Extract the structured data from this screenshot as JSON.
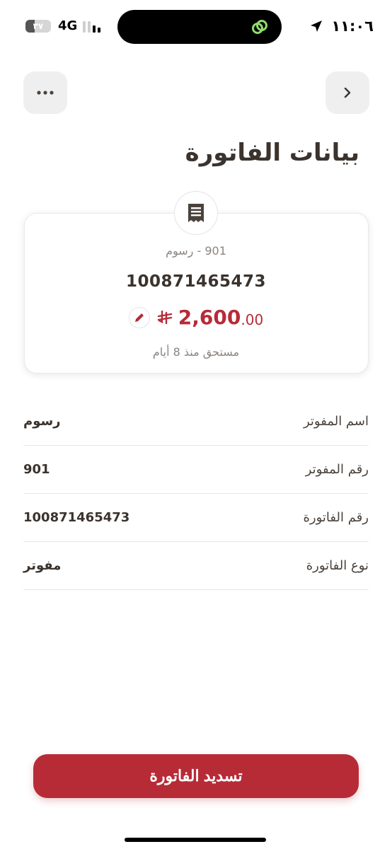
{
  "status_bar": {
    "time": "١١:٠٦",
    "network": "4G",
    "battery_label": "٣٧",
    "battery_level": 0.37
  },
  "header": {
    "title": "بيانات الفاتورة"
  },
  "bill_card": {
    "subtitle": "901 - رسوم",
    "bill_number": "100871465473",
    "amount_main": "2,600",
    "amount_decimal": ".00",
    "due_text": "مستحق منذ 8 أيام"
  },
  "details": [
    {
      "label": "اسم المفوتر",
      "value": "رسوم"
    },
    {
      "label": "رقم المفوتر",
      "value": "901"
    },
    {
      "label": "رقم الفاتورة",
      "value": "100871465473"
    },
    {
      "label": "نوع الفاتورة",
      "value": "مفوتر"
    }
  ],
  "pay_button": {
    "label": "تسديد الفاتورة"
  },
  "colors": {
    "accent": "#b72b37",
    "text": "#3b332d",
    "muted": "#8a8580"
  }
}
